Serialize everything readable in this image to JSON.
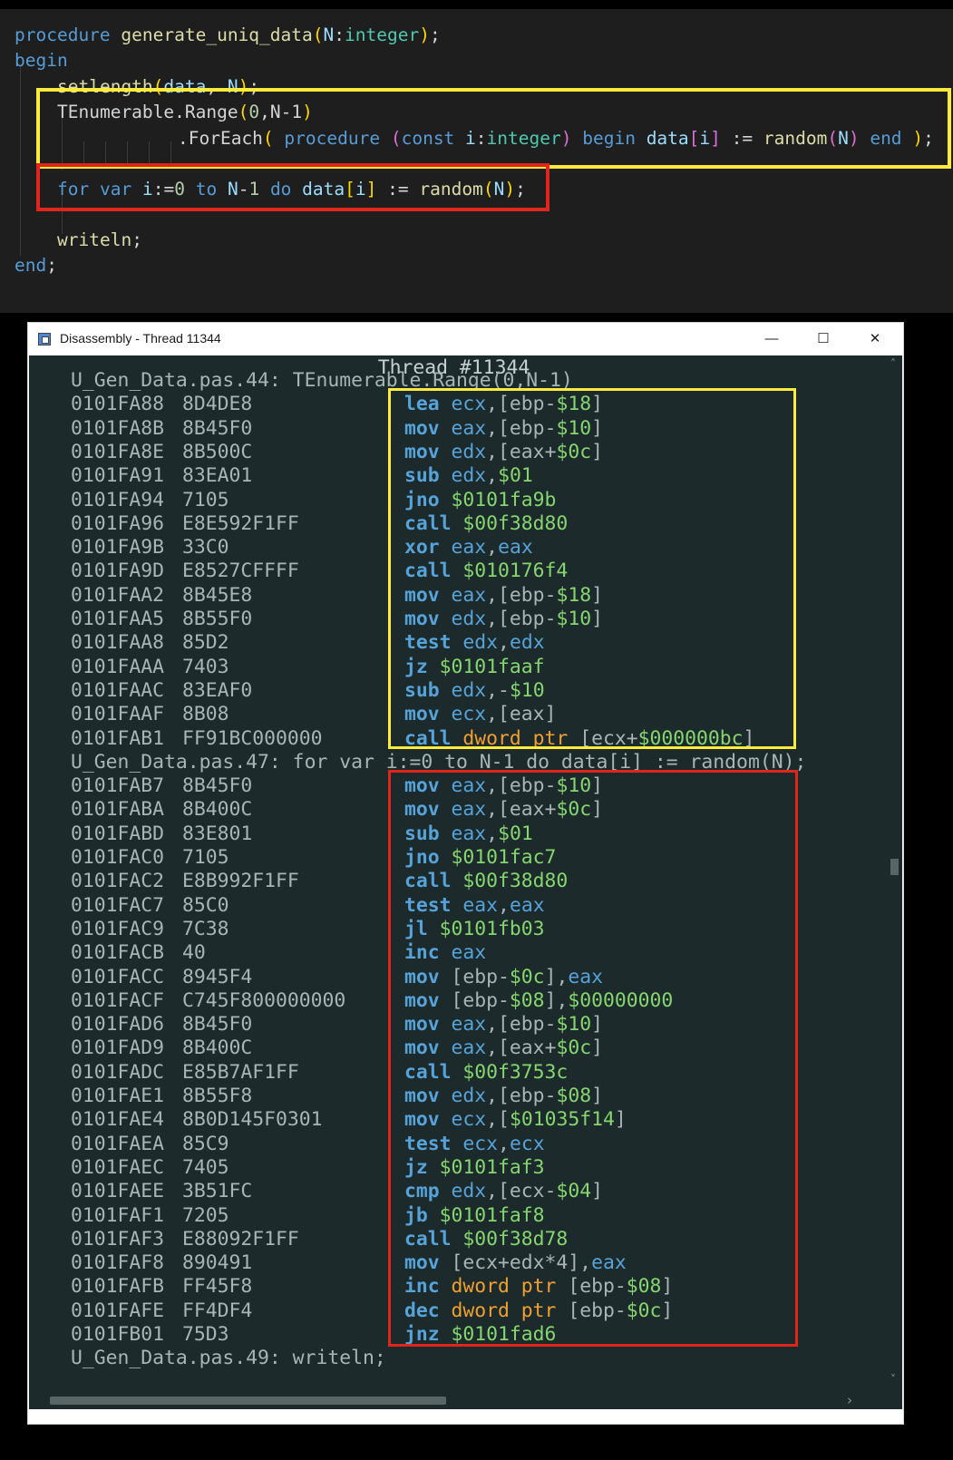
{
  "editor": {
    "lines": [
      {
        "tokens": [
          [
            "k",
            "procedure"
          ],
          [
            "d",
            " "
          ],
          [
            "f",
            "generate_uniq_data"
          ],
          [
            "pa",
            "("
          ],
          [
            "v",
            "N"
          ],
          [
            "d",
            ":"
          ],
          [
            "t",
            "integer"
          ],
          [
            "pa",
            ")"
          ],
          [
            "d",
            ";"
          ]
        ]
      },
      {
        "tokens": [
          [
            "k",
            "begin"
          ]
        ]
      },
      {
        "tokens": [
          [
            "f",
            "setlength"
          ],
          [
            "pa",
            "("
          ],
          [
            "v",
            "data"
          ],
          [
            "d",
            ", "
          ],
          [
            "v",
            "N"
          ],
          [
            "pa",
            ")"
          ],
          [
            "d",
            ";"
          ]
        ]
      },
      {
        "tokens": [
          [
            "d",
            "TEnumerable.Range"
          ],
          [
            "pa",
            "("
          ],
          [
            "n",
            "0"
          ],
          [
            "d",
            ",N-1"
          ],
          [
            "pa",
            ")"
          ]
        ]
      },
      {
        "tokens": [
          [
            "d",
            ".ForEach"
          ],
          [
            "pa",
            "("
          ],
          [
            "d",
            " "
          ],
          [
            "k",
            "procedure"
          ],
          [
            "d",
            " "
          ],
          [
            "pb",
            "("
          ],
          [
            "k",
            "const"
          ],
          [
            "d",
            " "
          ],
          [
            "v",
            "i"
          ],
          [
            "d",
            ":"
          ],
          [
            "t",
            "integer"
          ],
          [
            "pb",
            ")"
          ],
          [
            "d",
            " "
          ],
          [
            "k",
            "begin"
          ],
          [
            "d",
            " "
          ],
          [
            "v",
            "data"
          ],
          [
            "pb",
            "["
          ],
          [
            "v",
            "i"
          ],
          [
            "pb",
            "]"
          ],
          [
            "d",
            " := "
          ],
          [
            "f",
            "random"
          ],
          [
            "pb",
            "("
          ],
          [
            "v",
            "N"
          ],
          [
            "pb",
            ")"
          ],
          [
            "d",
            " "
          ],
          [
            "k",
            "end"
          ],
          [
            "d",
            " "
          ],
          [
            "pa",
            ")"
          ],
          [
            "d",
            ";"
          ]
        ]
      },
      {
        "tokens": [
          [
            "k",
            "for"
          ],
          [
            "d",
            " "
          ],
          [
            "k",
            "var"
          ],
          [
            "d",
            " "
          ],
          [
            "v",
            "i"
          ],
          [
            "d",
            ":="
          ],
          [
            "n",
            "0"
          ],
          [
            "d",
            " "
          ],
          [
            "k",
            "to"
          ],
          [
            "d",
            " "
          ],
          [
            "v",
            "N"
          ],
          [
            "d",
            "-"
          ],
          [
            "n",
            "1"
          ],
          [
            "d",
            " "
          ],
          [
            "k",
            "do"
          ],
          [
            "d",
            " "
          ],
          [
            "v",
            "data"
          ],
          [
            "pa",
            "["
          ],
          [
            "v",
            "i"
          ],
          [
            "pa",
            "]"
          ],
          [
            "d",
            " := "
          ],
          [
            "f",
            "random"
          ],
          [
            "pa",
            "("
          ],
          [
            "v",
            "N"
          ],
          [
            "pa",
            ")"
          ],
          [
            "d",
            ";"
          ]
        ]
      },
      {
        "tokens": [
          [
            "f",
            "writeln"
          ],
          [
            "d",
            ";"
          ]
        ]
      },
      {
        "tokens": [
          [
            "k",
            "end"
          ],
          [
            "d",
            ";"
          ]
        ]
      }
    ],
    "highlight_colors": {
      "yellow": "#ffeb3b",
      "red": "#e0261c"
    }
  },
  "window": {
    "title": "Disassembly - Thread 11344",
    "minimize_glyph": "—",
    "maximize_glyph": "☐",
    "close_glyph": "✕",
    "thread_header": "Thread #11344",
    "up_arrow": "˄",
    "down_arrow": "˅",
    "right_arrow": "›"
  },
  "disassembly": [
    {
      "source": "U_Gen_Data.pas.44: TEnumerable.Range(0,N-1)"
    },
    {
      "addr": "0101FA88",
      "hex": "8D4DE8",
      "asm": [
        [
          "m",
          "lea"
        ],
        [
          "p",
          " "
        ],
        [
          "r",
          "ecx"
        ],
        [
          "p",
          ",[ebp-"
        ],
        [
          "i",
          "$18"
        ],
        [
          "p",
          "]"
        ]
      ]
    },
    {
      "addr": "0101FA8B",
      "hex": "8B45F0",
      "asm": [
        [
          "m",
          "mov"
        ],
        [
          "p",
          " "
        ],
        [
          "r",
          "eax"
        ],
        [
          "p",
          ",[ebp-"
        ],
        [
          "i",
          "$10"
        ],
        [
          "p",
          "]"
        ]
      ]
    },
    {
      "addr": "0101FA8E",
      "hex": "8B500C",
      "asm": [
        [
          "m",
          "mov"
        ],
        [
          "p",
          " "
        ],
        [
          "r",
          "edx"
        ],
        [
          "p",
          ",[eax+"
        ],
        [
          "i",
          "$0c"
        ],
        [
          "p",
          "]"
        ]
      ]
    },
    {
      "addr": "0101FA91",
      "hex": "83EA01",
      "asm": [
        [
          "m",
          "sub"
        ],
        [
          "p",
          " "
        ],
        [
          "r",
          "edx"
        ],
        [
          "p",
          ","
        ],
        [
          "i",
          "$01"
        ]
      ]
    },
    {
      "addr": "0101FA94",
      "hex": "7105",
      "asm": [
        [
          "m",
          "jno"
        ],
        [
          "p",
          " "
        ],
        [
          "i",
          "$0101fa9b"
        ]
      ]
    },
    {
      "addr": "0101FA96",
      "hex": "E8E592F1FF",
      "asm": [
        [
          "m",
          "call"
        ],
        [
          "p",
          " "
        ],
        [
          "i",
          "$00f38d80"
        ]
      ]
    },
    {
      "addr": "0101FA9B",
      "hex": "33C0",
      "asm": [
        [
          "m",
          "xor"
        ],
        [
          "p",
          " "
        ],
        [
          "r",
          "eax"
        ],
        [
          "p",
          ","
        ],
        [
          "r",
          "eax"
        ]
      ]
    },
    {
      "addr": "0101FA9D",
      "hex": "E8527CFFFF",
      "asm": [
        [
          "m",
          "call"
        ],
        [
          "p",
          " "
        ],
        [
          "i",
          "$010176f4"
        ]
      ]
    },
    {
      "addr": "0101FAA2",
      "hex": "8B45E8",
      "asm": [
        [
          "m",
          "mov"
        ],
        [
          "p",
          " "
        ],
        [
          "r",
          "eax"
        ],
        [
          "p",
          ",[ebp-"
        ],
        [
          "i",
          "$18"
        ],
        [
          "p",
          "]"
        ]
      ]
    },
    {
      "addr": "0101FAA5",
      "hex": "8B55F0",
      "asm": [
        [
          "m",
          "mov"
        ],
        [
          "p",
          " "
        ],
        [
          "r",
          "edx"
        ],
        [
          "p",
          ",[ebp-"
        ],
        [
          "i",
          "$10"
        ],
        [
          "p",
          "]"
        ]
      ]
    },
    {
      "addr": "0101FAA8",
      "hex": "85D2",
      "asm": [
        [
          "m",
          "test"
        ],
        [
          "p",
          " "
        ],
        [
          "r",
          "edx"
        ],
        [
          "p",
          ","
        ],
        [
          "r",
          "edx"
        ]
      ]
    },
    {
      "addr": "0101FAAA",
      "hex": "7403",
      "asm": [
        [
          "m",
          "jz"
        ],
        [
          "p",
          " "
        ],
        [
          "i",
          "$0101faaf"
        ]
      ]
    },
    {
      "addr": "0101FAAC",
      "hex": "83EAF0",
      "asm": [
        [
          "m",
          "sub"
        ],
        [
          "p",
          " "
        ],
        [
          "r",
          "edx"
        ],
        [
          "p",
          ",-"
        ],
        [
          "i",
          "$10"
        ]
      ]
    },
    {
      "addr": "0101FAAF",
      "hex": "8B08",
      "asm": [
        [
          "m",
          "mov"
        ],
        [
          "p",
          " "
        ],
        [
          "r",
          "ecx"
        ],
        [
          "p",
          ",[eax]"
        ]
      ]
    },
    {
      "addr": "0101FAB1",
      "hex": "FF91BC000000",
      "asm": [
        [
          "m",
          "call"
        ],
        [
          "p",
          " "
        ],
        [
          "w",
          "dword ptr"
        ],
        [
          "p",
          " [ecx+"
        ],
        [
          "i",
          "$000000bc"
        ],
        [
          "p",
          "]"
        ]
      ]
    },
    {
      "source": "U_Gen_Data.pas.47: for var i:=0 to N-1 do data[i] := random(N);"
    },
    {
      "addr": "0101FAB7",
      "hex": "8B45F0",
      "asm": [
        [
          "m",
          "mov"
        ],
        [
          "p",
          " "
        ],
        [
          "r",
          "eax"
        ],
        [
          "p",
          ",[ebp-"
        ],
        [
          "i",
          "$10"
        ],
        [
          "p",
          "]"
        ]
      ]
    },
    {
      "addr": "0101FABA",
      "hex": "8B400C",
      "asm": [
        [
          "m",
          "mov"
        ],
        [
          "p",
          " "
        ],
        [
          "r",
          "eax"
        ],
        [
          "p",
          ",[eax+"
        ],
        [
          "i",
          "$0c"
        ],
        [
          "p",
          "]"
        ]
      ]
    },
    {
      "addr": "0101FABD",
      "hex": "83E801",
      "asm": [
        [
          "m",
          "sub"
        ],
        [
          "p",
          " "
        ],
        [
          "r",
          "eax"
        ],
        [
          "p",
          ","
        ],
        [
          "i",
          "$01"
        ]
      ]
    },
    {
      "addr": "0101FAC0",
      "hex": "7105",
      "asm": [
        [
          "m",
          "jno"
        ],
        [
          "p",
          " "
        ],
        [
          "i",
          "$0101fac7"
        ]
      ]
    },
    {
      "addr": "0101FAC2",
      "hex": "E8B992F1FF",
      "asm": [
        [
          "m",
          "call"
        ],
        [
          "p",
          " "
        ],
        [
          "i",
          "$00f38d80"
        ]
      ]
    },
    {
      "addr": "0101FAC7",
      "hex": "85C0",
      "asm": [
        [
          "m",
          "test"
        ],
        [
          "p",
          " "
        ],
        [
          "r",
          "eax"
        ],
        [
          "p",
          ","
        ],
        [
          "r",
          "eax"
        ]
      ]
    },
    {
      "addr": "0101FAC9",
      "hex": "7C38",
      "asm": [
        [
          "m",
          "jl"
        ],
        [
          "p",
          " "
        ],
        [
          "i",
          "$0101fb03"
        ]
      ]
    },
    {
      "addr": "0101FACB",
      "hex": "40",
      "asm": [
        [
          "m",
          "inc"
        ],
        [
          "p",
          " "
        ],
        [
          "r",
          "eax"
        ]
      ]
    },
    {
      "addr": "0101FACC",
      "hex": "8945F4",
      "asm": [
        [
          "m",
          "mov"
        ],
        [
          "p",
          " [ebp-"
        ],
        [
          "i",
          "$0c"
        ],
        [
          "p",
          "],"
        ],
        [
          "r",
          "eax"
        ]
      ]
    },
    {
      "addr": "0101FACF",
      "hex": "C745F800000000",
      "asm": [
        [
          "m",
          "mov"
        ],
        [
          "p",
          " [ebp-"
        ],
        [
          "i",
          "$08"
        ],
        [
          "p",
          "],"
        ],
        [
          "i",
          "$00000000"
        ]
      ]
    },
    {
      "addr": "0101FAD6",
      "hex": "8B45F0",
      "asm": [
        [
          "m",
          "mov"
        ],
        [
          "p",
          " "
        ],
        [
          "r",
          "eax"
        ],
        [
          "p",
          ",[ebp-"
        ],
        [
          "i",
          "$10"
        ],
        [
          "p",
          "]"
        ]
      ]
    },
    {
      "addr": "0101FAD9",
      "hex": "8B400C",
      "asm": [
        [
          "m",
          "mov"
        ],
        [
          "p",
          " "
        ],
        [
          "r",
          "eax"
        ],
        [
          "p",
          ",[eax+"
        ],
        [
          "i",
          "$0c"
        ],
        [
          "p",
          "]"
        ]
      ]
    },
    {
      "addr": "0101FADC",
      "hex": "E85B7AF1FF",
      "asm": [
        [
          "m",
          "call"
        ],
        [
          "p",
          " "
        ],
        [
          "i",
          "$00f3753c"
        ]
      ]
    },
    {
      "addr": "0101FAE1",
      "hex": "8B55F8",
      "asm": [
        [
          "m",
          "mov"
        ],
        [
          "p",
          " "
        ],
        [
          "r",
          "edx"
        ],
        [
          "p",
          ",[ebp-"
        ],
        [
          "i",
          "$08"
        ],
        [
          "p",
          "]"
        ]
      ]
    },
    {
      "addr": "0101FAE4",
      "hex": "8B0D145F0301",
      "asm": [
        [
          "m",
          "mov"
        ],
        [
          "p",
          " "
        ],
        [
          "r",
          "ecx"
        ],
        [
          "p",
          ",["
        ],
        [
          "i",
          "$01035f14"
        ],
        [
          "p",
          "]"
        ]
      ]
    },
    {
      "addr": "0101FAEA",
      "hex": "85C9",
      "asm": [
        [
          "m",
          "test"
        ],
        [
          "p",
          " "
        ],
        [
          "r",
          "ecx"
        ],
        [
          "p",
          ","
        ],
        [
          "r",
          "ecx"
        ]
      ]
    },
    {
      "addr": "0101FAEC",
      "hex": "7405",
      "asm": [
        [
          "m",
          "jz"
        ],
        [
          "p",
          " "
        ],
        [
          "i",
          "$0101faf3"
        ]
      ]
    },
    {
      "addr": "0101FAEE",
      "hex": "3B51FC",
      "asm": [
        [
          "m",
          "cmp"
        ],
        [
          "p",
          " "
        ],
        [
          "r",
          "edx"
        ],
        [
          "p",
          ",[ecx-"
        ],
        [
          "i",
          "$04"
        ],
        [
          "p",
          "]"
        ]
      ]
    },
    {
      "addr": "0101FAF1",
      "hex": "7205",
      "asm": [
        [
          "m",
          "jb"
        ],
        [
          "p",
          " "
        ],
        [
          "i",
          "$0101faf8"
        ]
      ]
    },
    {
      "addr": "0101FAF3",
      "hex": "E88092F1FF",
      "asm": [
        [
          "m",
          "call"
        ],
        [
          "p",
          " "
        ],
        [
          "i",
          "$00f38d78"
        ]
      ]
    },
    {
      "addr": "0101FAF8",
      "hex": "890491",
      "asm": [
        [
          "m",
          "mov"
        ],
        [
          "p",
          " [ecx+edx*4],"
        ],
        [
          "r",
          "eax"
        ]
      ]
    },
    {
      "addr": "0101FAFB",
      "hex": "FF45F8",
      "asm": [
        [
          "m",
          "inc"
        ],
        [
          "p",
          " "
        ],
        [
          "w",
          "dword ptr"
        ],
        [
          "p",
          " [ebp-"
        ],
        [
          "i",
          "$08"
        ],
        [
          "p",
          "]"
        ]
      ]
    },
    {
      "addr": "0101FAFE",
      "hex": "FF4DF4",
      "asm": [
        [
          "m",
          "dec"
        ],
        [
          "p",
          " "
        ],
        [
          "w",
          "dword ptr"
        ],
        [
          "p",
          " [ebp-"
        ],
        [
          "i",
          "$0c"
        ],
        [
          "p",
          "]"
        ]
      ]
    },
    {
      "addr": "0101FB01",
      "hex": "75D3",
      "asm": [
        [
          "m",
          "jnz"
        ],
        [
          "p",
          " "
        ],
        [
          "i",
          "$0101fad6"
        ]
      ]
    },
    {
      "source": "U_Gen_Data.pas.49: writeln;"
    }
  ],
  "colors": {
    "disasm_bg": "#1c2a2b",
    "editor_bg": "#1e1e1e",
    "yellow": "#ffeb3b",
    "red": "#e0261c"
  }
}
